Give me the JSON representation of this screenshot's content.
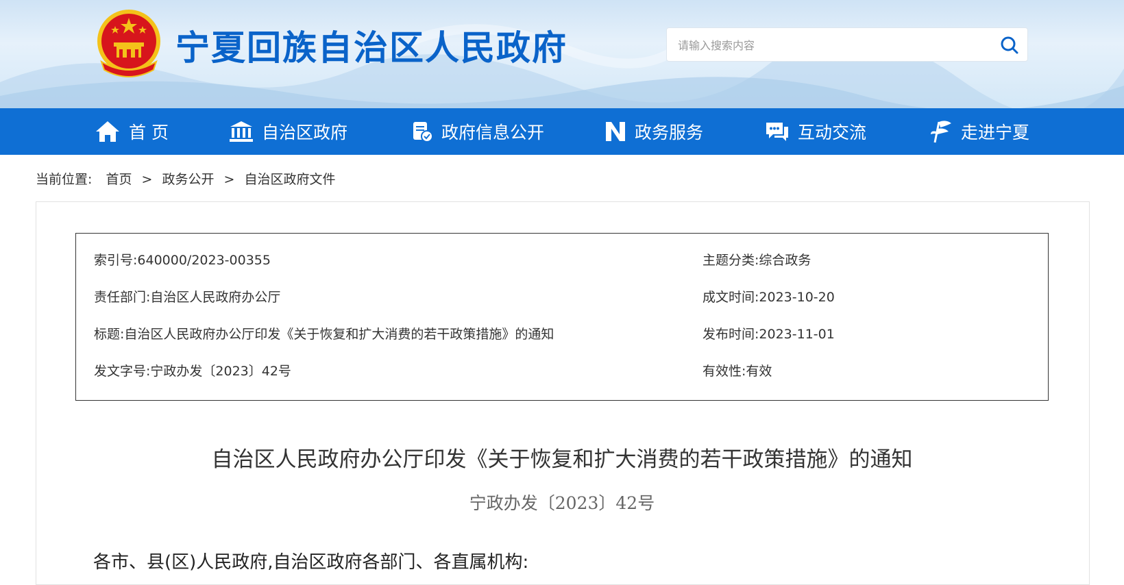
{
  "header": {
    "site_title": "宁夏回族自治区人民政府",
    "search_placeholder": "请输入搜索内容"
  },
  "nav": {
    "items": [
      {
        "label": "首 页",
        "icon": "home-icon"
      },
      {
        "label": "自治区政府",
        "icon": "government-building-icon"
      },
      {
        "label": "政府信息公开",
        "icon": "document-check-icon"
      },
      {
        "label": "政务服务",
        "icon": "service-n-icon"
      },
      {
        "label": "互动交流",
        "icon": "chat-icon"
      },
      {
        "label": "走进宁夏",
        "icon": "flag-icon"
      }
    ]
  },
  "breadcrumb": {
    "prefix": "当前位置:",
    "items": [
      "首页",
      "政务公开",
      "自治区政府文件"
    ],
    "separator": ">"
  },
  "meta": {
    "index_no": "索引号:640000/2023-00355",
    "topic": "主题分类:综合政务",
    "department": "责任部门:自治区人民政府办公厅",
    "written_date": "成文时间:2023-10-20",
    "title": "标题:自治区人民政府办公厅印发《关于恢复和扩大消费的若干政策措施》的通知",
    "publish_date": "发布时间:2023-11-01",
    "doc_no": "发文字号:宁政办发〔2023〕42号",
    "validity": "有效性:有效"
  },
  "document": {
    "title": "自治区人民政府办公厅印发《关于恢复和扩大消费的若干政策措施》的通知",
    "number": "宁政办发〔2023〕42号",
    "salutation": "各市、县(区)人民政府,自治区政府各部门、各直属机构:"
  },
  "colors": {
    "brand_blue": "#0a63c9",
    "nav_blue": "#0f6fd4",
    "emblem_red": "#d7151c",
    "emblem_gold": "#f4c21a"
  }
}
